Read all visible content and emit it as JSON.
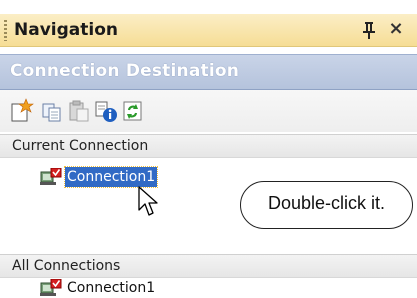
{
  "panel": {
    "title": "Navigation",
    "pin_glyph": "Ѩ",
    "close_glyph": "×",
    "pin_icon": "pin-icon",
    "close_icon": "close-icon"
  },
  "destination": {
    "heading": "Connection Destination"
  },
  "toolbar": {
    "buttons": [
      {
        "name": "new-connection-button",
        "icon": "new-item-icon"
      },
      {
        "name": "copy-button",
        "icon": "copy-icon"
      },
      {
        "name": "paste-button",
        "icon": "paste-icon"
      },
      {
        "name": "properties-button",
        "icon": "info-icon"
      },
      {
        "name": "refresh-button",
        "icon": "refresh-icon"
      }
    ]
  },
  "current": {
    "heading": "Current Connection",
    "items": [
      {
        "label": "Connection1",
        "icon": "connection-icon",
        "selected": true
      }
    ]
  },
  "all": {
    "heading": "All Connections",
    "items": [
      {
        "label": "Connection1",
        "icon": "connection-icon",
        "selected": false
      }
    ]
  },
  "annotation": {
    "callout_text": "Double-click it."
  },
  "colors": {
    "title_bar": "#f6dd95",
    "header_blue": "#b5c3dc",
    "selection": "#316ac5"
  }
}
